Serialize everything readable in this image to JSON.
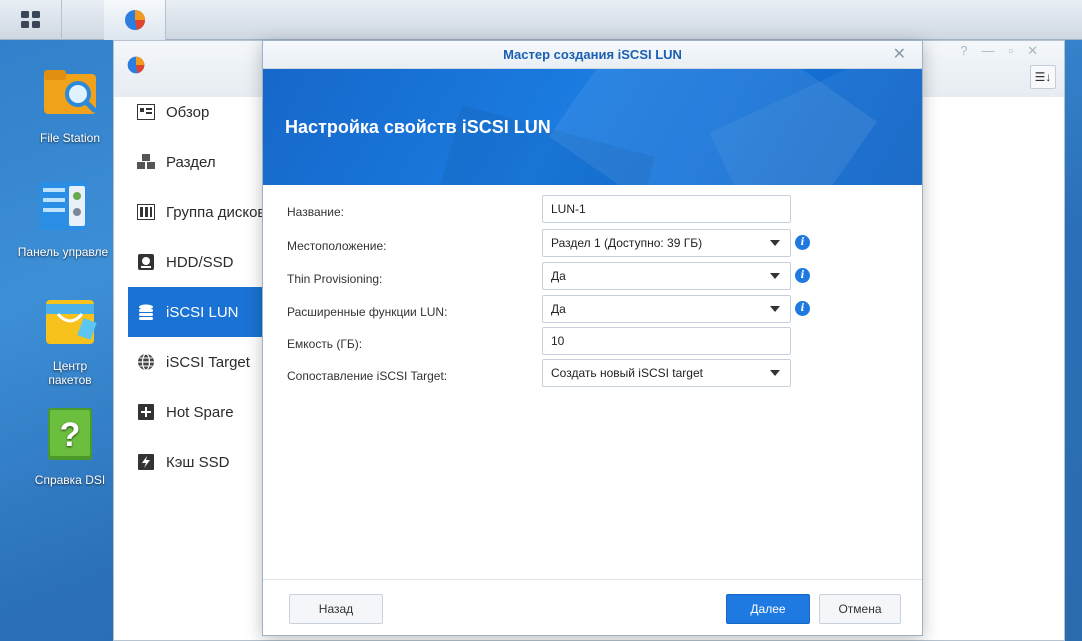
{
  "taskbar": {
    "main_menu_icon": "grid-menu-icon",
    "storage_app_icon": "storage-manager-icon"
  },
  "desktop": {
    "icons": [
      {
        "label": "File Station",
        "icon": "folder-search-icon"
      },
      {
        "label": "Панель управле",
        "icon": "control-panel-icon"
      },
      {
        "label": "Центр пакетов",
        "icon": "package-center-icon"
      },
      {
        "label": "Справка DSI",
        "icon": "help-book-icon"
      }
    ]
  },
  "storage_manager": {
    "nav": [
      {
        "label": "Обзор",
        "icon": "overview-icon",
        "active": false
      },
      {
        "label": "Раздел",
        "icon": "volume-cubes-icon",
        "active": false
      },
      {
        "label": "Группа дисков",
        "icon": "disk-group-icon",
        "active": false
      },
      {
        "label": "HDD/SSD",
        "icon": "hdd-icon",
        "active": false
      },
      {
        "label": "iSCSI LUN",
        "icon": "lun-stack-icon",
        "active": true
      },
      {
        "label": "iSCSI Target",
        "icon": "globe-target-icon",
        "active": false
      },
      {
        "label": "Hot Spare",
        "icon": "hot-spare-icon",
        "active": false
      },
      {
        "label": "Кэш SSD",
        "icon": "ssd-cache-icon",
        "active": false
      }
    ],
    "controls": {
      "help": "?",
      "minimize": "—",
      "maximize": "▫",
      "close": "✕",
      "sort": "☰↓"
    }
  },
  "wizard": {
    "title": "Мастер создания iSCSI LUN",
    "heading": "Настройка свойств iSCSI LUN",
    "fields": {
      "name": {
        "label": "Название:",
        "value": "LUN-1"
      },
      "location": {
        "label": "Местоположение:",
        "value": "Раздел 1 (Доступно: 39 ГБ)"
      },
      "thin": {
        "label": "Thin Provisioning:",
        "value": "Да"
      },
      "advanced": {
        "label": "Расширенные функции LUN:",
        "value": "Да"
      },
      "capacity": {
        "label": "Емкость (ГБ):",
        "value": "10"
      },
      "mapping": {
        "label": "Сопоставление iSCSI Target:",
        "value": "Создать новый iSCSI target"
      }
    },
    "buttons": {
      "back": "Назад",
      "next": "Далее",
      "cancel": "Отмена"
    },
    "accent_color": "#1e79e0"
  }
}
